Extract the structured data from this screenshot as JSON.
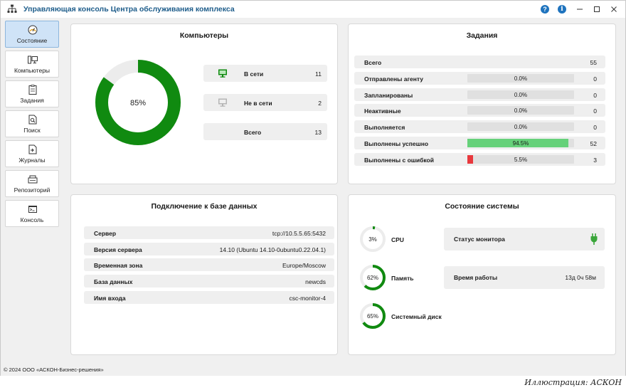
{
  "window": {
    "title": "Управляющая консоль Центра обслуживания комплекса"
  },
  "titlebar_buttons": {
    "help": "?",
    "info": "i"
  },
  "sidebar": {
    "items": [
      {
        "label": "Состояние",
        "icon": "dashboard-icon",
        "active": true
      },
      {
        "label": "Компьютеры",
        "icon": "computers-icon"
      },
      {
        "label": "Задания",
        "icon": "tasks-icon"
      },
      {
        "label": "Поиск",
        "icon": "search-icon"
      },
      {
        "label": "Журналы",
        "icon": "logs-icon"
      },
      {
        "label": "Репозиторий",
        "icon": "repository-icon"
      },
      {
        "label": "Консоль",
        "icon": "console-icon"
      }
    ]
  },
  "computers": {
    "title": "Компьютеры",
    "donut_percent": 0.85,
    "donut_label": "85%",
    "rows": [
      {
        "label": "В сети",
        "value": "11",
        "icon": "monitor-online-icon"
      },
      {
        "label": "Не в сети",
        "value": "2",
        "icon": "monitor-offline-icon"
      },
      {
        "label": "Всего",
        "value": "13"
      }
    ]
  },
  "tasks": {
    "title": "Задания",
    "total_label": "Всего",
    "total_value": "55",
    "rows": [
      {
        "label": "Отправлены агенту",
        "percent_text": "0.0%",
        "fraction": 0.0,
        "value": "0",
        "color": "#e0e0e0"
      },
      {
        "label": "Запланированы",
        "percent_text": "0.0%",
        "fraction": 0.0,
        "value": "0",
        "color": "#e0e0e0"
      },
      {
        "label": "Неактивные",
        "percent_text": "0.0%",
        "fraction": 0.0,
        "value": "0",
        "color": "#e0e0e0"
      },
      {
        "label": "Выполняется",
        "percent_text": "0.0%",
        "fraction": 0.0,
        "value": "0",
        "color": "#e0e0e0"
      },
      {
        "label": "Выполнены успешно",
        "percent_text": "94.5%",
        "fraction": 0.945,
        "value": "52",
        "color": "#66d17a"
      },
      {
        "label": "Выполнены с ошибкой",
        "percent_text": "5.5%",
        "fraction": 0.055,
        "value": "3",
        "color": "#e8383d"
      }
    ]
  },
  "database": {
    "title": "Подключение к базе данных",
    "rows": [
      {
        "label": "Сервер",
        "value": "tcp://10.5.5.65:5432"
      },
      {
        "label": "Версия сервера",
        "value": "14.10 (Ubuntu 14.10-0ubuntu0.22.04.1)"
      },
      {
        "label": "Временная зона",
        "value": "Europe/Moscow"
      },
      {
        "label": "База данных",
        "value": "newcds"
      },
      {
        "label": "Имя входа",
        "value": "csc-monitor-4"
      }
    ]
  },
  "system": {
    "title": "Состояние системы",
    "gauges": [
      {
        "label": "CPU",
        "percent_text": "3%",
        "fraction": 0.03
      },
      {
        "label": "Память",
        "percent_text": "62%",
        "fraction": 0.62
      },
      {
        "label": "Системный диск",
        "percent_text": "65%",
        "fraction": 0.65
      }
    ],
    "monitor_status_label": "Статус монитора",
    "monitor_status_icon": "plug-connected-icon",
    "uptime_label": "Время работы",
    "uptime_value": "13д 0ч 58м"
  },
  "colors": {
    "accent_green": "#108a10",
    "title_blue": "#1d5c8a",
    "active_nav": "#cfe3f7"
  },
  "footer": {
    "copyright": "© 2024 ООО «АСКОН-Бизнес-решения»"
  },
  "caption": "Иллюстрация: АСКОН"
}
